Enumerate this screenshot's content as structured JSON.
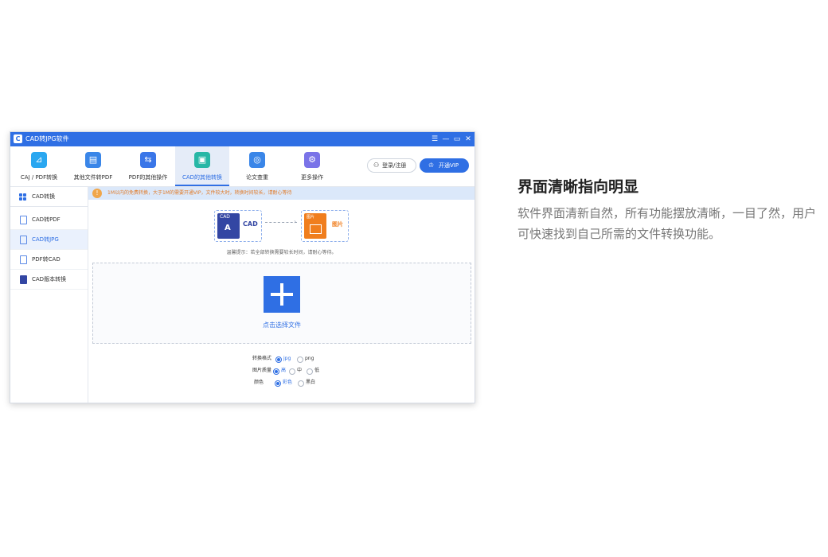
{
  "window": {
    "title": "CAD转JPG软件",
    "logo_glyph": "C",
    "controls": {
      "menu": "☰",
      "minimize": "—",
      "maximize": "▭",
      "close": "✕"
    }
  },
  "toolbar": {
    "tabs": [
      {
        "label": "CAJ / PDF转换",
        "icon": "caj-pdf-convert-icon",
        "color": "#2aa7f0",
        "glyph": "⊿"
      },
      {
        "label": "其他文件转PDF",
        "icon": "folder-file-icon",
        "color": "#3a86e8",
        "glyph": "▤"
      },
      {
        "label": "PDF的其他操作",
        "icon": "pdf-operations-icon",
        "color": "#3a76e8",
        "glyph": "⇆"
      },
      {
        "label": "CAD的其他转换",
        "icon": "cad-convert-icon",
        "color": "#27b7a6",
        "glyph": "▣"
      },
      {
        "label": "论文查重",
        "icon": "paper-check-icon",
        "color": "#3a86e8",
        "glyph": "◎"
      },
      {
        "label": "更多操作",
        "icon": "more-ops-icon",
        "color": "#7a73e8",
        "glyph": "⚙"
      }
    ],
    "active_index": 3,
    "login_label": "登录/注册",
    "vip_label": "开通VIP"
  },
  "sidebar": {
    "header": "CAD转换",
    "items": [
      {
        "label": "CAD转PDF",
        "selected": false
      },
      {
        "label": "CAD转JPG",
        "selected": true
      },
      {
        "label": "PDF转CAD",
        "selected": false
      },
      {
        "label": "CAD版本转换",
        "selected": false
      }
    ]
  },
  "main": {
    "notice": "1M以内的免费转换，大于1M的需要开通VIP，文件较大时，转换时间较长，请耐心等待",
    "source_badge": "CAD",
    "source_label": "CAD",
    "source_glyph": "A",
    "target_badge": "图片",
    "target_label": "图片",
    "arrow_glyph": "›",
    "tip": "温馨提示：若全部转换需要较长时间，请耐心等待。",
    "drop_label": "点击选择文件",
    "options": [
      {
        "label": "转换格式",
        "choices": [
          "jpg",
          "png"
        ],
        "selected": 0
      },
      {
        "label": "图片质量",
        "choices": [
          "高",
          "中",
          "低"
        ],
        "selected": 0
      },
      {
        "label": "颜色",
        "choices": [
          "彩色",
          "黑白"
        ],
        "selected": 0
      }
    ]
  },
  "feature": {
    "title": "界面清晰指向明显",
    "description": "软件界面清新自然，所有功能摆放清晰，一目了然，用户可快速找到自己所需的文件转换功能。"
  },
  "colors": {
    "primary": "#2f6fe4",
    "orange": "#f07e1e",
    "cad_blue": "#3346a3"
  }
}
